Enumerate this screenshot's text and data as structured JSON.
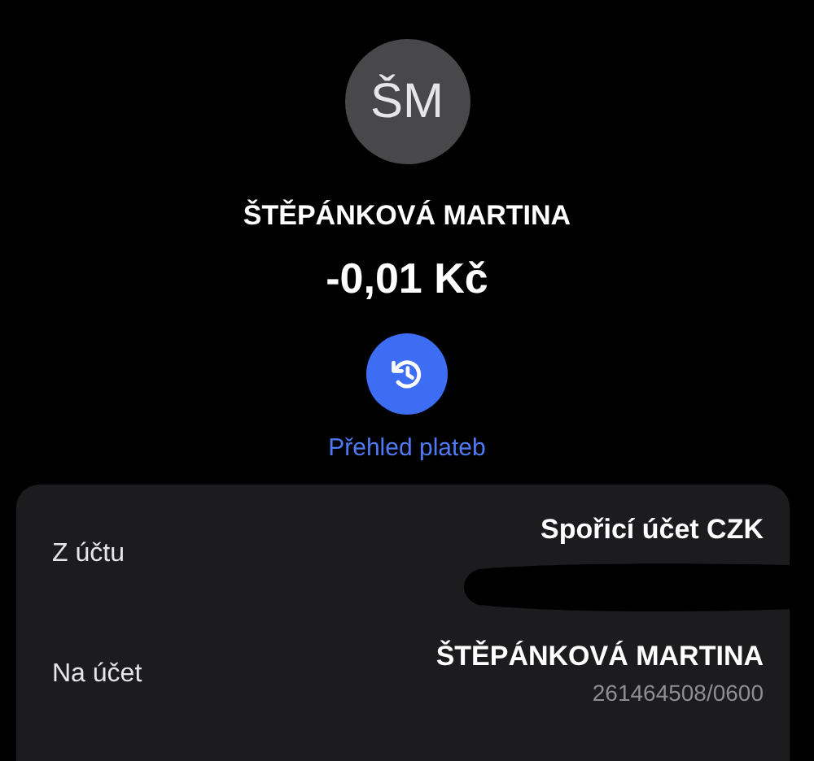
{
  "header": {
    "initials": "ŠM",
    "name": "ŠTĚPÁNKOVÁ MARTINA",
    "amount": "-0,01 Kč"
  },
  "history_link": {
    "label": "Přehled plateb"
  },
  "details": [
    {
      "label": "Z účtu",
      "value": "Spořicí účet CZK",
      "redacted": true
    },
    {
      "label": "Na účet",
      "value": "ŠTĚPÁNKOVÁ MARTINA",
      "sub": "261464508/0600",
      "redacted": false
    }
  ]
}
